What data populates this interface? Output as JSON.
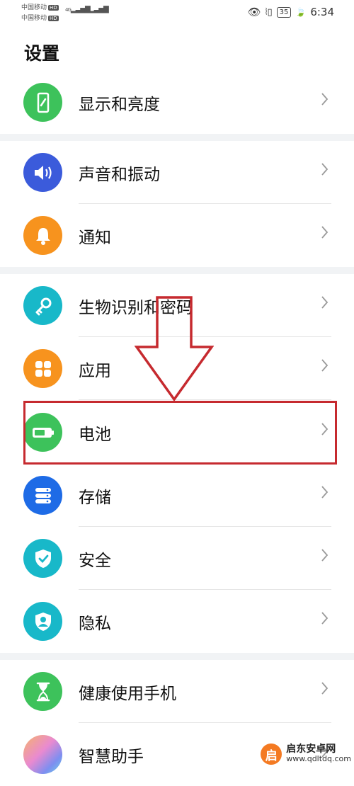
{
  "status_bar": {
    "carrier_1": "中国移动",
    "carrier_2": "中国移动",
    "hd_badge": "HD",
    "network": "4G",
    "battery_level": "35",
    "time": "6:34"
  },
  "page": {
    "title": "设置"
  },
  "settings_items": [
    {
      "label": "显示和亮度",
      "icon": "display-icon",
      "color": "#3dc25b"
    },
    {
      "label": "声音和振动",
      "icon": "speaker-icon",
      "color": "#3b5bdb"
    },
    {
      "label": "通知",
      "icon": "bell-icon",
      "color": "#f7931e"
    },
    {
      "label": "生物识别和密码",
      "icon": "key-icon",
      "color": "#18b8c9"
    },
    {
      "label": "应用",
      "icon": "apps-grid-icon",
      "color": "#f7931e"
    },
    {
      "label": "电池",
      "icon": "battery-icon",
      "color": "#3dc25b"
    },
    {
      "label": "存储",
      "icon": "storage-icon",
      "color": "#1e6be6"
    },
    {
      "label": "安全",
      "icon": "shield-check-icon",
      "color": "#18b8c9"
    },
    {
      "label": "隐私",
      "icon": "privacy-icon",
      "color": "#18b8c9"
    },
    {
      "label": "健康使用手机",
      "icon": "hourglass-icon",
      "color": "#3dc25b"
    },
    {
      "label": "智慧助手",
      "icon": "assistant-icon",
      "color": "#e98ad0"
    }
  ],
  "watermark": {
    "logo_char": "启",
    "name": "启东安卓网",
    "url": "www.qdltdq.com"
  }
}
